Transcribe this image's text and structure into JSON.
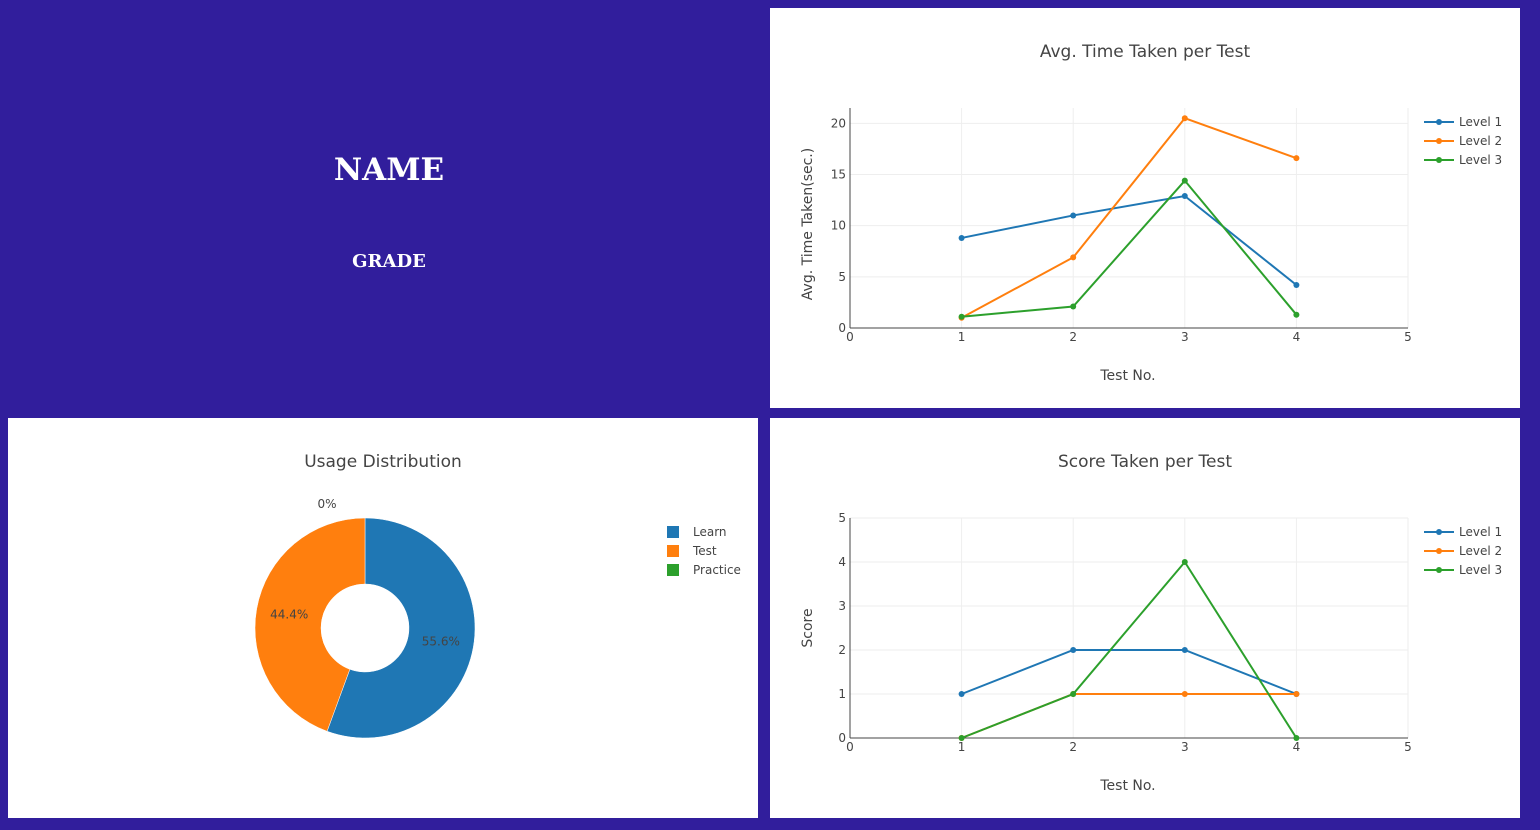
{
  "profile": {
    "name": "NAME",
    "grade": "GRADE"
  },
  "colors": {
    "background": "#311e9c",
    "level1": "#1f77b4",
    "level2": "#ff7f0e",
    "level3": "#2ca02c"
  },
  "time_chart": {
    "title": "Avg. Time Taken per Test",
    "xlabel": "Test No.",
    "ylabel": "Avg. Time Taken(sec.)"
  },
  "score_chart": {
    "title": "Score Taken per Test",
    "xlabel": "Test No.",
    "ylabel": "Score"
  },
  "usage_chart": {
    "title": "Usage Distribution"
  },
  "chart_data": [
    {
      "type": "line",
      "title": "Avg. Time Taken per Test",
      "xlabel": "Test No.",
      "ylabel": "Avg. Time Taken(sec.)",
      "xlim": [
        0,
        5
      ],
      "ylim": [
        0,
        21.5
      ],
      "xticks": [
        0,
        1,
        2,
        3,
        4,
        5
      ],
      "yticks": [
        0,
        5,
        10,
        15,
        20
      ],
      "grid": true,
      "legend": "top-right",
      "x": [
        1,
        2,
        3,
        4
      ],
      "series": [
        {
          "name": "Level 1",
          "color": "#1f77b4",
          "values": [
            8.8,
            11.0,
            12.9,
            4.2
          ]
        },
        {
          "name": "Level 2",
          "color": "#ff7f0e",
          "values": [
            1.0,
            6.9,
            20.5,
            16.6
          ]
        },
        {
          "name": "Level 3",
          "color": "#2ca02c",
          "values": [
            1.1,
            2.1,
            14.4,
            1.3
          ]
        }
      ]
    },
    {
      "type": "line",
      "title": "Score Taken per Test",
      "xlabel": "Test No.",
      "ylabel": "Score",
      "xlim": [
        0,
        5
      ],
      "ylim": [
        0,
        5
      ],
      "xticks": [
        0,
        1,
        2,
        3,
        4,
        5
      ],
      "yticks": [
        0,
        1,
        2,
        3,
        4,
        5
      ],
      "grid": true,
      "legend": "top-right",
      "x": [
        1,
        2,
        3,
        4
      ],
      "series": [
        {
          "name": "Level 1",
          "color": "#1f77b4",
          "values": [
            1,
            2,
            2,
            1
          ]
        },
        {
          "name": "Level 2",
          "color": "#ff7f0e",
          "values": [
            0,
            1,
            1,
            1
          ]
        },
        {
          "name": "Level 3",
          "color": "#2ca02c",
          "values": [
            0,
            1,
            4,
            0
          ]
        }
      ]
    },
    {
      "type": "pie",
      "title": "Usage Distribution",
      "hole": 0.4,
      "legend": "top-right",
      "labels": [
        "Learn",
        "Test",
        "Practice"
      ],
      "values": [
        55.6,
        44.4,
        0
      ],
      "percent_labels": [
        "55.6%",
        "44.4%",
        "0%"
      ],
      "colors": [
        "#1f77b4",
        "#ff7f0e",
        "#2ca02c"
      ]
    }
  ]
}
